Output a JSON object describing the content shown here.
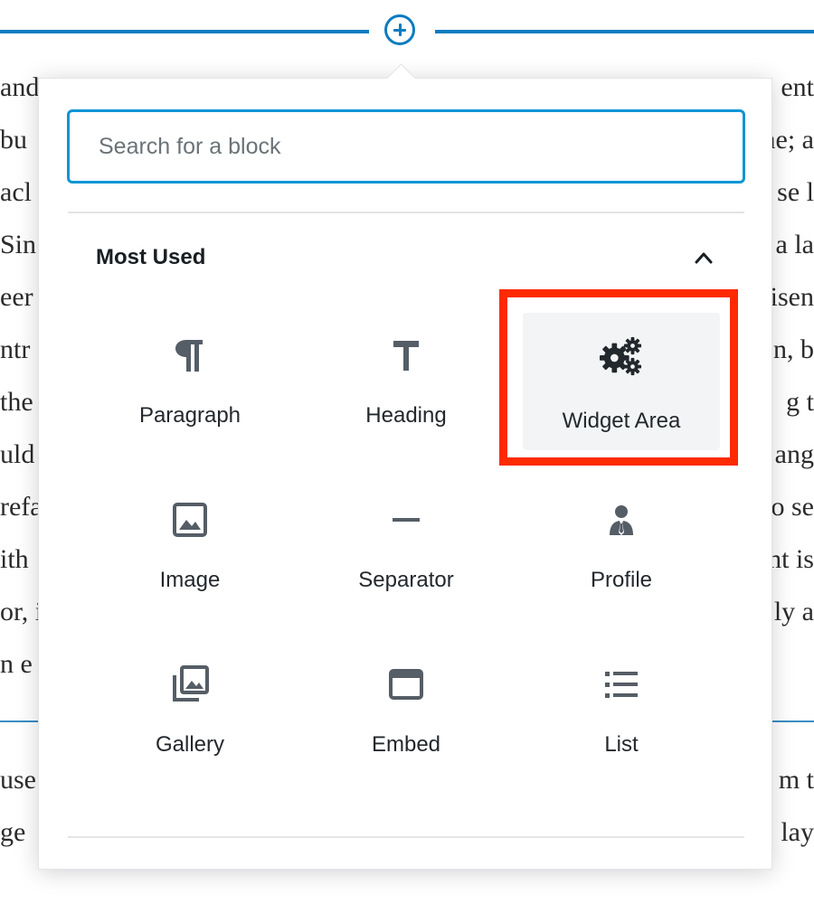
{
  "inserter": {
    "icon": "plus-circle-icon"
  },
  "background_text": {
    "left": [
      "and",
      "bu",
      "acl",
      "Sin",
      "eer",
      "ntr",
      "the",
      "uld",
      "refa",
      "ith",
      "or,  i",
      "n e",
      "use",
      "ge"
    ],
    "right": [
      "ent",
      "ne; a",
      "se l",
      "a la",
      "isen",
      "n, b",
      "g  t",
      "ang",
      "o se",
      "nt is",
      "ly a",
      "",
      "m t",
      "lay"
    ]
  },
  "search": {
    "placeholder": "Search for a block",
    "value": ""
  },
  "panel": {
    "title": "Most Used",
    "toggle_icon": "chevron-up-icon"
  },
  "blocks": [
    {
      "label": "Paragraph",
      "icon": "paragraph-icon"
    },
    {
      "label": "Heading",
      "icon": "heading-icon"
    },
    {
      "label": "Widget Area",
      "icon": "gears-icon"
    },
    {
      "label": "Image",
      "icon": "image-icon"
    },
    {
      "label": "Separator",
      "icon": "separator-icon"
    },
    {
      "label": "Profile",
      "icon": "profile-icon"
    },
    {
      "label": "Gallery",
      "icon": "gallery-icon"
    },
    {
      "label": "Embed",
      "icon": "embed-icon"
    },
    {
      "label": "List",
      "icon": "list-icon"
    }
  ],
  "colors": {
    "accent": "#0a7cc0",
    "search_border": "#0a95d4",
    "highlight_box": "#ff2a00",
    "icon": "#555d66"
  }
}
